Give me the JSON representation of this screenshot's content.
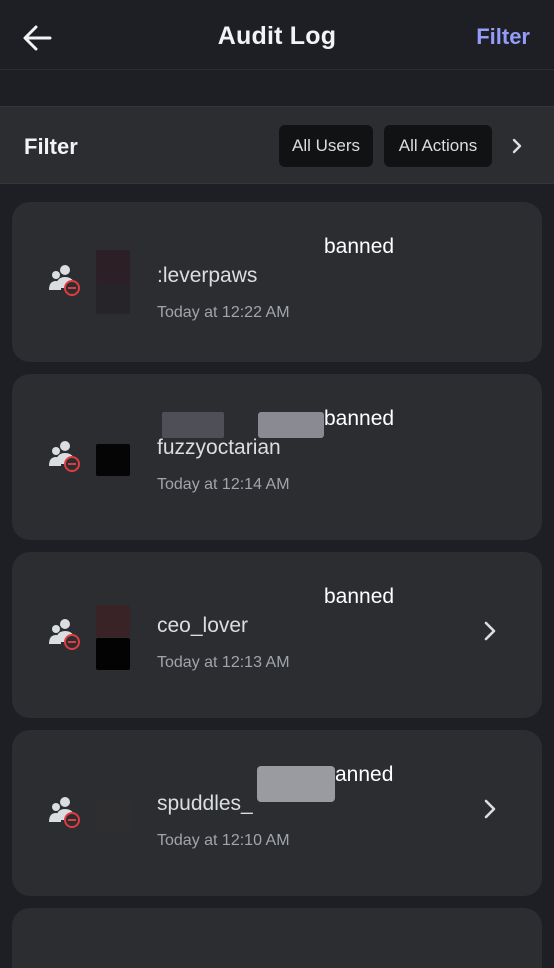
{
  "header": {
    "title": "Audit Log",
    "filter_label": "Filter",
    "back_icon": "arrow-left-icon"
  },
  "filter_bar": {
    "label": "Filter",
    "chips": [
      "All Users",
      "All Actions"
    ],
    "more_icon": "chevron-right-icon"
  },
  "entries": [
    {
      "action": "banned",
      "username": "leverpaws",
      "time": "Today at 12:22 AM",
      "icon": "member-ban-icon"
    },
    {
      "action": "banned",
      "username": "fuzzyoctarian",
      "time": "Today at 12:14 AM",
      "icon": "member-ban-icon"
    },
    {
      "action": "banned",
      "username": "ceo_lover",
      "time": "Today at 12:13 AM",
      "icon": "member-ban-icon"
    },
    {
      "action": "anned",
      "username": "spuddles_",
      "time": "Today at 12:10 AM",
      "icon": "member-ban-icon"
    }
  ],
  "colors": {
    "background": "#1e1f24",
    "card": "#2b2d31",
    "accent": "#949cf7",
    "ban_red": "#e03c41"
  }
}
